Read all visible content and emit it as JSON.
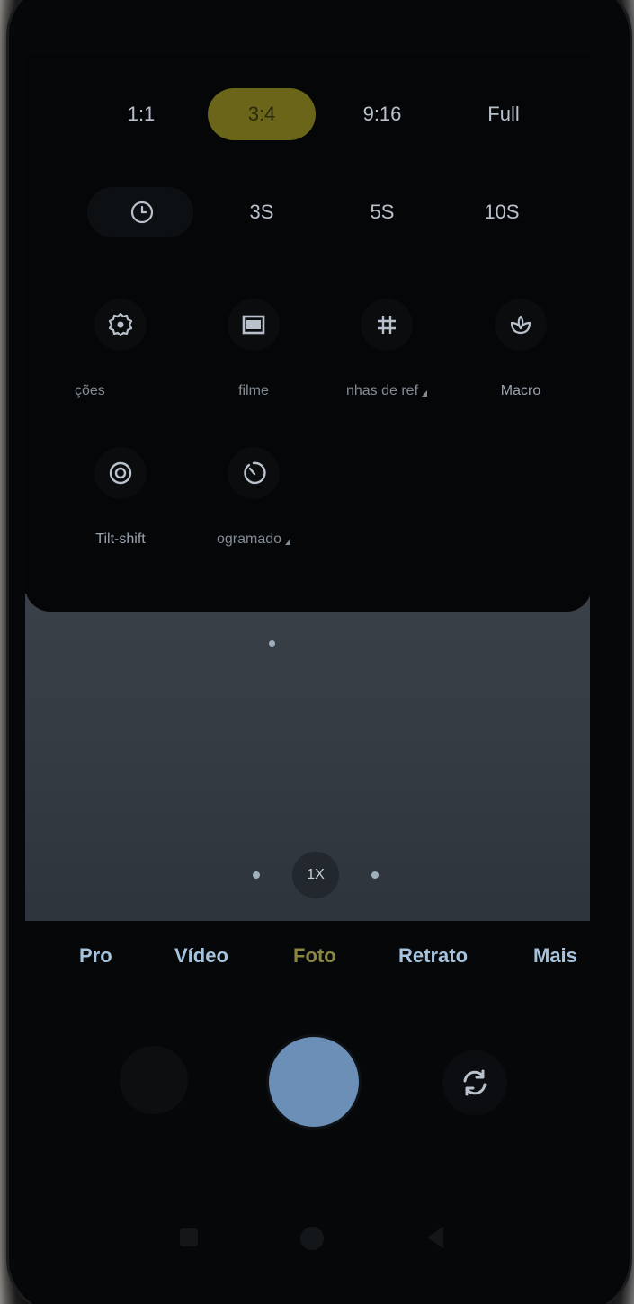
{
  "aspect_ratios": [
    {
      "label": "1:1",
      "selected": false
    },
    {
      "label": "3:4",
      "selected": true
    },
    {
      "label": "9:16",
      "selected": false
    },
    {
      "label": "Full",
      "selected": false
    }
  ],
  "timer": {
    "off_icon": "clock-icon",
    "options": [
      "3S",
      "5S",
      "10S"
    ]
  },
  "settings_tiles": [
    {
      "label": "ções",
      "icon": "gear-icon"
    },
    {
      "label": "filme",
      "icon": "film-frame-icon"
    },
    {
      "label": "nhas de ref",
      "icon": "grid-hash-icon"
    },
    {
      "label": "Macro",
      "icon": "macro-flower-icon"
    },
    {
      "label": "Tilt-shift",
      "icon": "tilt-shift-icon"
    },
    {
      "label": "ogramado",
      "icon": "timer-dial-icon"
    }
  ],
  "zoom": {
    "label": "1X"
  },
  "modes": [
    {
      "label": "Pro",
      "active": false
    },
    {
      "label": "Vídeo",
      "active": false
    },
    {
      "label": "Foto",
      "active": true
    },
    {
      "label": "Retrato",
      "active": false
    },
    {
      "label": "Mais",
      "active": false
    }
  ],
  "colors": {
    "accent": "#8a8640",
    "selected_ratio_bg": "#6a6518",
    "mode_text": "#a6c3de",
    "shutter": "#6b8fb6"
  },
  "controls": {
    "gallery": "gallery-thumbnail",
    "shutter": "shutter-button",
    "switch_camera": "switch-camera-icon"
  }
}
